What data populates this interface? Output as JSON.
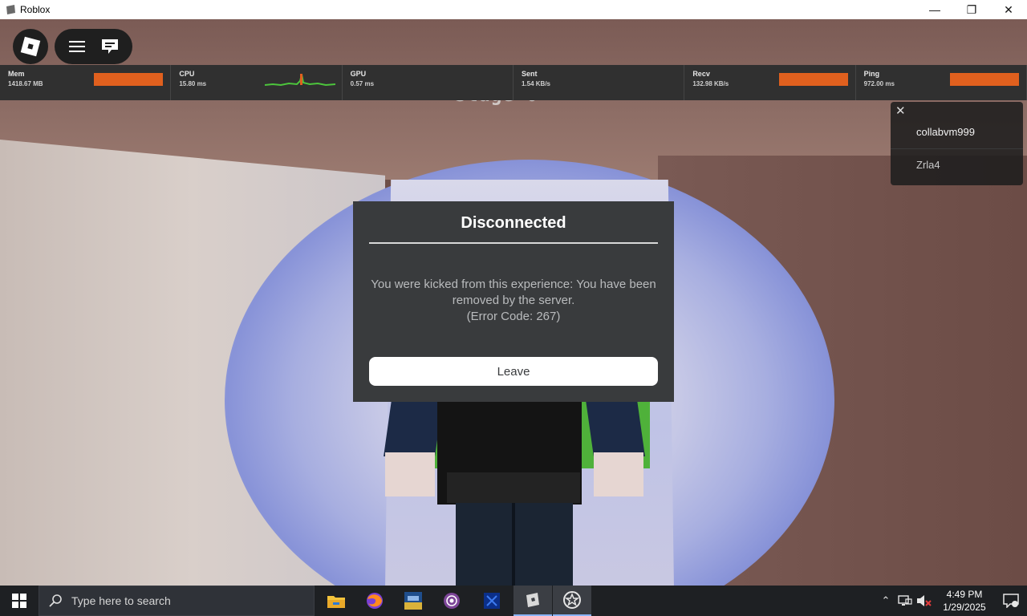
{
  "window": {
    "title": "Roblox",
    "minimize_glyph": "—",
    "maximize_glyph": "❐",
    "close_glyph": "✕"
  },
  "hud": {
    "stage_label": "Stage 0",
    "stats": [
      {
        "label": "Mem",
        "value": "1418.67 MB",
        "indicator": "bar"
      },
      {
        "label": "CPU",
        "value": "15.80 ms",
        "indicator": "graph"
      },
      {
        "label": "GPU",
        "value": "0.57 ms",
        "indicator": "none"
      },
      {
        "label": "Sent",
        "value": "1.54 KB/s",
        "indicator": "none"
      },
      {
        "label": "Recv",
        "value": "132.98 KB/s",
        "indicator": "bar"
      },
      {
        "label": "Ping",
        "value": "972.00 ms",
        "indicator": "bar"
      }
    ],
    "alert_color": "#e0601e"
  },
  "players": {
    "close_glyph": "✕",
    "list": [
      "collabvm999",
      "Zrla4"
    ]
  },
  "dialog": {
    "title": "Disconnected",
    "message_line1": "You were kicked from this experience: You have been removed by the server.",
    "message_line2": "(Error Code: 267)",
    "leave_label": "Leave"
  },
  "taskbar": {
    "search_placeholder": "Type here to search",
    "apps": [
      "file-explorer-icon",
      "firefox-icon",
      "app-2025-icon",
      "tor-browser-icon",
      "shield-app-icon",
      "roblox-icon",
      "roblox-studio-icon"
    ],
    "clock_time": "4:49 PM",
    "clock_date": "1/29/2025",
    "tray_chevron": "⌃"
  }
}
